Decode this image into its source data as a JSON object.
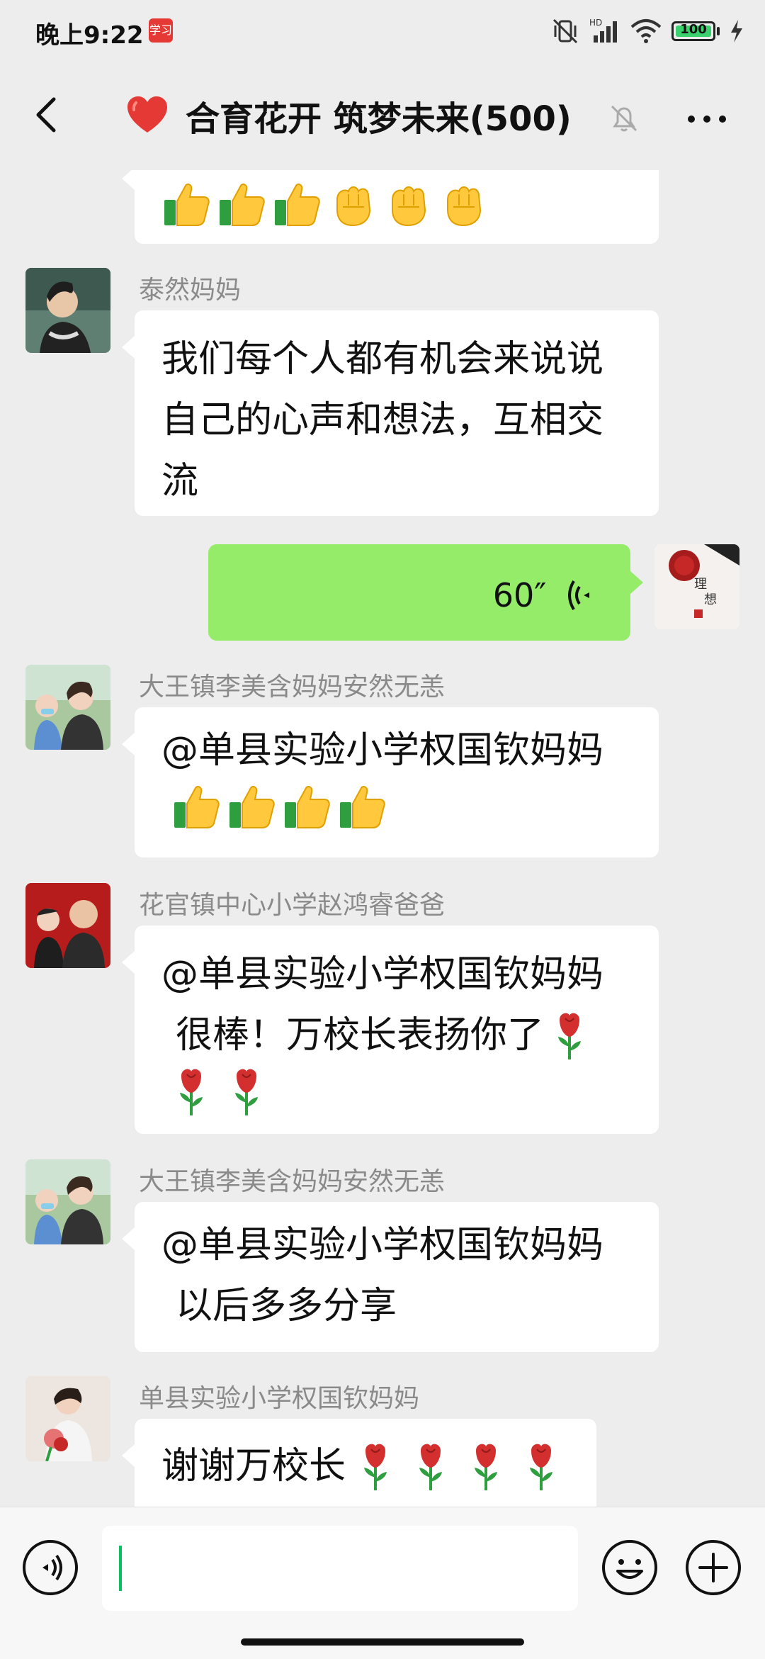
{
  "status_bar": {
    "time": "晚上9:22",
    "app_badge": "学习",
    "network": "HD",
    "battery": "100"
  },
  "header": {
    "title": "合育花开 筑梦未来(500)"
  },
  "messages": [
    {
      "sender": "",
      "text": "",
      "emojis": [
        "thumbs-up",
        "thumbs-up",
        "thumbs-up",
        "fist",
        "fist",
        "fist"
      ]
    },
    {
      "sender": "泰然妈妈",
      "text": "我们每个人都有机会来说说自己的心声和想法，互相交流"
    },
    {
      "sender": "",
      "voice_duration": "60″"
    },
    {
      "sender": "大王镇李美含妈妈安然无恙",
      "text": "@单县实验小学权国钦妈妈",
      "emojis": [
        "thumbs-up",
        "thumbs-up",
        "thumbs-up",
        "thumbs-up"
      ]
    },
    {
      "sender": "花官镇中心小学赵鸿睿爸爸",
      "text1": "@单县实验小学权国钦妈妈",
      "text2": "很棒！万校长表扬你了",
      "emojis": [
        "rose",
        "rose",
        "rose"
      ]
    },
    {
      "sender": "大王镇李美含妈妈安然无恙",
      "text1": "@单县实验小学权国钦妈妈",
      "text2": "以后多多分享"
    },
    {
      "sender": "单县实验小学权国钦妈妈",
      "text": "谢谢万校长",
      "emojis": [
        "rose",
        "rose",
        "rose",
        "rose"
      ]
    }
  ],
  "icons": {
    "back": "chevron-left-icon",
    "heart": "heart-icon",
    "mute": "bell-slash-icon",
    "more": "more-icon",
    "voice": "voice-icon",
    "emoji": "smile-icon",
    "plus": "plus-icon"
  },
  "colors": {
    "background": "#EDEDED",
    "bubble_self": "#95EC69",
    "bubble_other": "#FFFFFF",
    "accent": "#07C160",
    "heart": "#E53935"
  }
}
